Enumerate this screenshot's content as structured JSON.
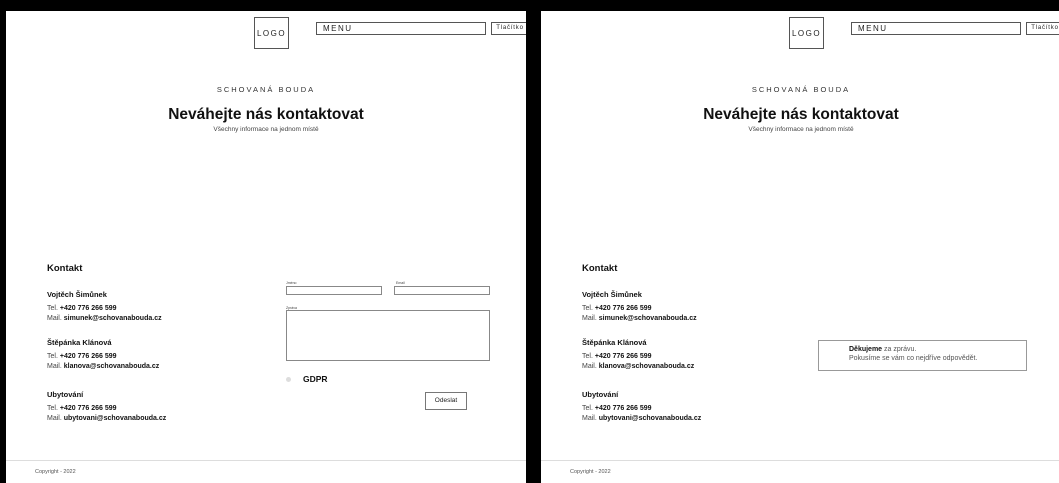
{
  "header": {
    "logo": "LOGO",
    "menu": "MENU",
    "button": "Tlačítko"
  },
  "hero": {
    "brand": "SCHOVANÁ BOUDA",
    "title": "Neváhejte nás kontaktovat",
    "subtitle": "Všechny informace na jednom místě"
  },
  "contact": {
    "title": "Kontakt",
    "tel_prefix": "Tel.",
    "mail_prefix": "Mail.",
    "people": [
      {
        "name": "Vojtěch Šimůnek",
        "phone": "+420 776 266 599",
        "email": "simunek@schovanabouda.cz"
      },
      {
        "name": "Štěpánka Klánová",
        "phone": "+420 776 266 599",
        "email": "klanova@schovanabouda.cz"
      },
      {
        "name": "Ubytování",
        "phone": "+420 776 266 599",
        "email": "ubytovani@schovanabouda.cz"
      }
    ]
  },
  "form": {
    "name_label": "Jméno",
    "email_label": "Email",
    "message_label": "Zpráva",
    "name_value": "",
    "email_value": "",
    "message_value": "",
    "gdpr_label": "GDPR",
    "submit_label": "Odeslat"
  },
  "thanks": {
    "bold": "Děkujeme",
    "rest": " za zprávu.",
    "line2": "Pokusíme se vám co nejdříve odpovědět."
  },
  "footer": {
    "copyright": "Copyright - 2022"
  }
}
